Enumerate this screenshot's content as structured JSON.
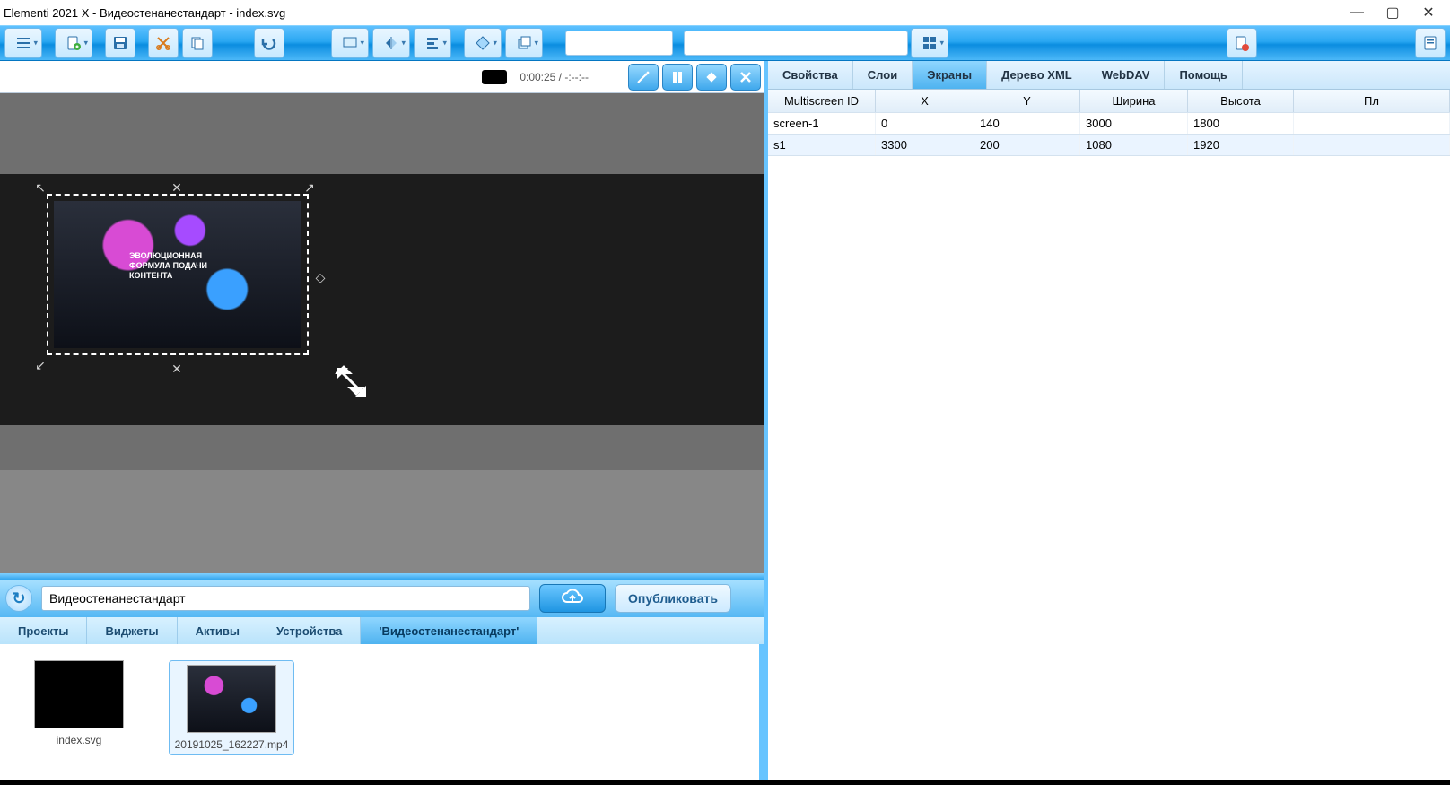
{
  "window": {
    "title": "Elementi 2021 X - Видеостенанестандарт - index.svg"
  },
  "preview": {
    "time": "0:00:25 / -:--:--"
  },
  "publish": {
    "input_value": "Видеостенанестандарт",
    "button_label": "Опубликовать"
  },
  "bottom_tabs": {
    "items": [
      {
        "label": "Проекты"
      },
      {
        "label": "Виджеты"
      },
      {
        "label": "Активы"
      },
      {
        "label": "Устройства"
      },
      {
        "label": "'Видеостенанестандарт'"
      }
    ],
    "active_index": 4
  },
  "assets": [
    {
      "label": "index.svg"
    },
    {
      "label": "20191025_162227.mp4"
    }
  ],
  "right_tabs": {
    "items": [
      {
        "label": "Свойства"
      },
      {
        "label": "Слои"
      },
      {
        "label": "Экраны"
      },
      {
        "label": "Дерево XML"
      },
      {
        "label": "WebDAV"
      },
      {
        "label": "Помощь"
      }
    ],
    "active_index": 2
  },
  "table": {
    "headers": {
      "id": "Multiscreen ID",
      "x": "X",
      "y": "Y",
      "w": "Ширина",
      "h": "Высота",
      "last": "Пл"
    },
    "rows": [
      {
        "id": "screen-1",
        "x": "0",
        "y": "140",
        "w": "3000",
        "h": "1800"
      },
      {
        "id": "s1",
        "x": "3300",
        "y": "200",
        "w": "1080",
        "h": "1920"
      }
    ]
  },
  "canvas_text": {
    "line1": "ЭВОЛЮЦИОННАЯ",
    "line2": "ФОРМУЛА ПОДАЧИ",
    "line3": "КОНТЕНТА"
  }
}
